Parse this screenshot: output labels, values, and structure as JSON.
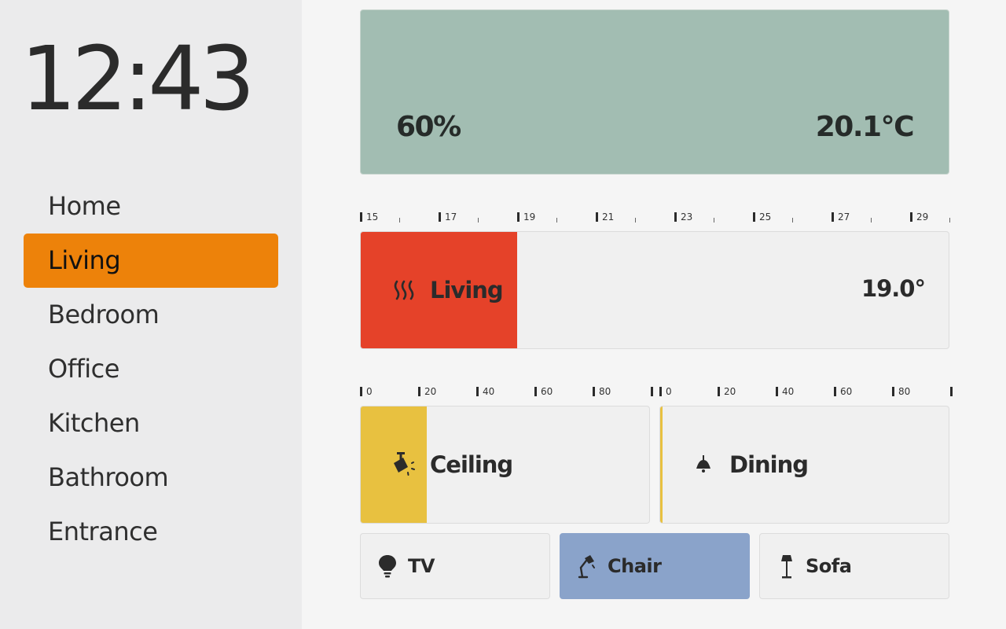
{
  "clock": "12:43",
  "nav": {
    "items": [
      {
        "label": "Home"
      },
      {
        "label": "Living"
      },
      {
        "label": "Bedroom"
      },
      {
        "label": "Office"
      },
      {
        "label": "Kitchen"
      },
      {
        "label": "Bathroom"
      },
      {
        "label": "Entrance"
      }
    ],
    "active_index": 1
  },
  "summary": {
    "humidity": "60%",
    "temperature": "20.1°C"
  },
  "thermostat": {
    "name": "Living",
    "value": "19.0°",
    "scale": {
      "min": 15,
      "max": 30,
      "labels": [
        "15",
        "17",
        "19",
        "21",
        "23",
        "25",
        "27",
        "29"
      ]
    },
    "setpoint": 19.0,
    "icon": "heat-waves-icon"
  },
  "dimmers": [
    {
      "name": "Ceiling",
      "level": 23,
      "icon": "spotlight-icon",
      "scale_labels": [
        "0",
        "20",
        "40",
        "60",
        "80"
      ]
    },
    {
      "name": "Dining",
      "level": 0,
      "icon": "pendant-lamp-icon",
      "scale_labels": [
        "0",
        "20",
        "40",
        "60",
        "80"
      ]
    }
  ],
  "switches": [
    {
      "name": "TV",
      "on": false,
      "icon": "bulb-icon"
    },
    {
      "name": "Chair",
      "on": true,
      "icon": "desk-lamp-icon"
    },
    {
      "name": "Sofa",
      "on": false,
      "icon": "floor-lamp-icon"
    }
  ],
  "colors": {
    "accent": "#ed820a",
    "hero_bg": "#a2bdb2",
    "heat": "#e54229",
    "dimmer": "#e8c140",
    "switch_on": "#8aa3ca"
  }
}
